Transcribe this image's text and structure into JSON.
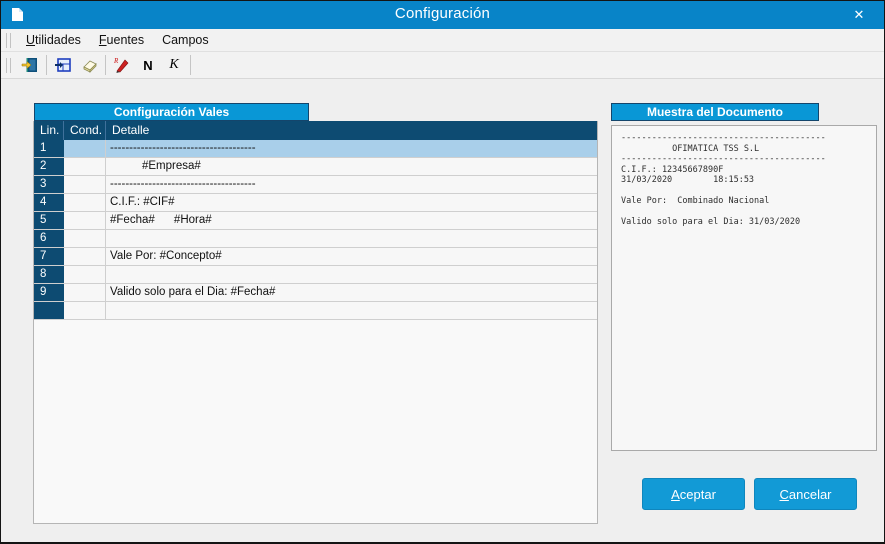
{
  "window": {
    "title": "Configuración",
    "close_glyph": "✕"
  },
  "menu": {
    "items": [
      {
        "label": "Utilidades"
      },
      {
        "label": "Fuentes"
      },
      {
        "label": "Campos"
      }
    ]
  },
  "toolbar": {
    "bold_label": "N",
    "italic_label": "K"
  },
  "vales": {
    "header": "Configuración Vales",
    "columns": [
      "Lin.",
      "Cond.",
      "Detalle"
    ],
    "rows": [
      {
        "lin": "1",
        "cond": "",
        "detalle": "--------------------------------------",
        "selected": true
      },
      {
        "lin": "2",
        "cond": "",
        "detalle": "          #Empresa#",
        "selected": false
      },
      {
        "lin": "3",
        "cond": "",
        "detalle": "--------------------------------------",
        "selected": false
      },
      {
        "lin": "4",
        "cond": "",
        "detalle": "C.I.F.: #CIF#",
        "selected": false
      },
      {
        "lin": "5",
        "cond": "",
        "detalle": "#Fecha#      #Hora#",
        "selected": false
      },
      {
        "lin": "6",
        "cond": "",
        "detalle": "",
        "selected": false
      },
      {
        "lin": "7",
        "cond": "",
        "detalle": "Vale Por: #Concepto#",
        "selected": false
      },
      {
        "lin": "8",
        "cond": "",
        "detalle": "",
        "selected": false
      },
      {
        "lin": "9",
        "cond": "",
        "detalle": "Valido solo para el Dia: #Fecha#",
        "selected": false
      },
      {
        "lin": "",
        "cond": "",
        "detalle": "",
        "selected": false
      }
    ]
  },
  "muestra": {
    "header": "Muestra del Documento",
    "preview": "----------------------------------------\n          OFIMATICA TSS S.L\n----------------------------------------\nC.I.F.: 12345667890F\n31/03/2020        18:15:53\n\nVale Por:  Combinado Nacional\n\nValido solo para el Dia: 31/03/2020"
  },
  "buttons": {
    "accept": "Aceptar",
    "cancel": "Cancelar"
  },
  "colors": {
    "titlebar": "#0884c8",
    "section_header": "#0997d6",
    "table_header": "#0d4b72",
    "selection": "#a9cfea",
    "button": "#129ad6"
  }
}
